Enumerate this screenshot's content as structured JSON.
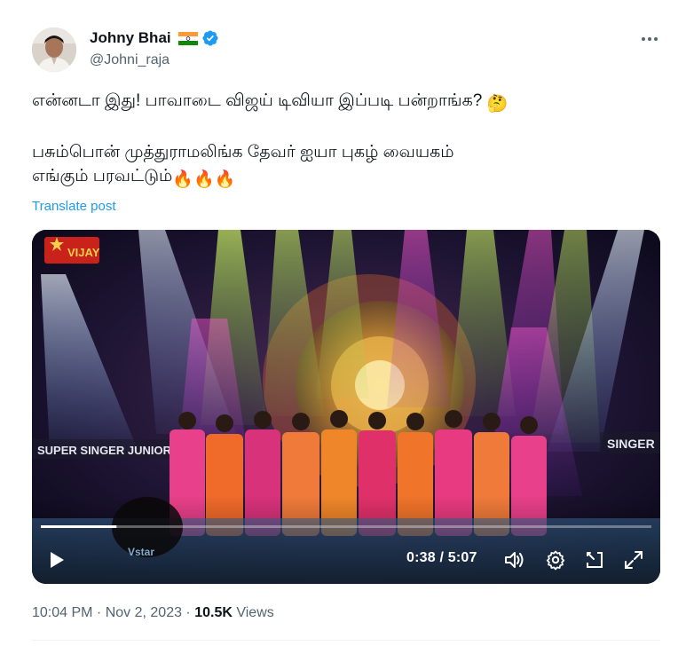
{
  "author": {
    "display_name": "Johny Bhai",
    "handle": "@Johni_raja",
    "flag_icon": "india-flag-icon",
    "verified_icon": "verified-badge-icon",
    "verified_color": "#1d9bf0"
  },
  "tweet": {
    "line1": "என்னடா இது! பாவாடை விஜய் டிவியா இப்படி பன்றாங்க?",
    "line1_emoji": "🤔",
    "line2": " பசும்பொன் முத்துராமலிங்க  தேவர் ஐயா புகழ் வையகம்",
    "line3": "எங்கும் பரவட்டும்",
    "line3_emoji": "🔥🔥🔥",
    "translate_label": "Translate post"
  },
  "video": {
    "current_time": "0:38",
    "separator": " / ",
    "duration": "5:07",
    "progress": 0.124,
    "channel_logo_text": "VIJAY",
    "banner_left": "SUPER SINGER JUNIOR",
    "banner_right": "SINGER",
    "watermark": "Vstar"
  },
  "meta": {
    "time": "10:04 PM",
    "dot1": " · ",
    "date": "Nov 2, 2023",
    "dot2": " · ",
    "views_count": "10.5K",
    "views_label": " Views"
  },
  "colors": {
    "text": "#0f1419",
    "secondary": "#536471",
    "link": "#1d9bf0"
  }
}
